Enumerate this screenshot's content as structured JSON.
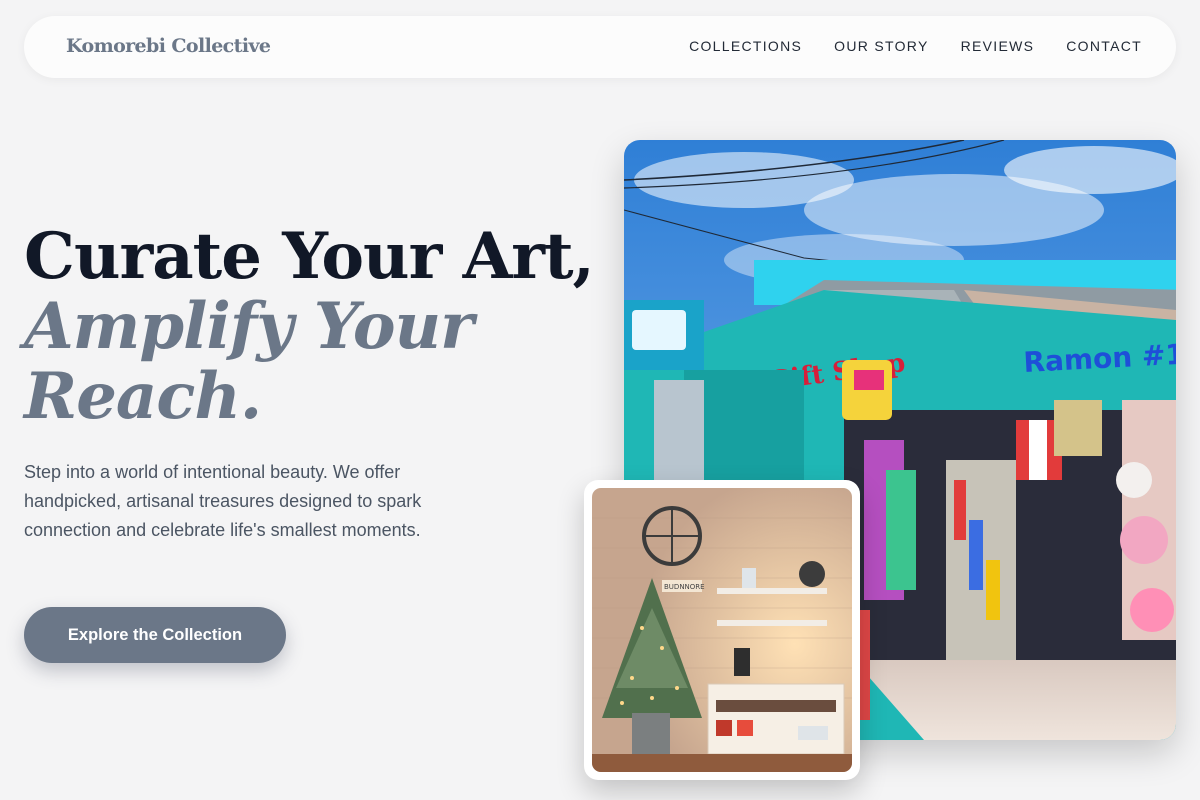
{
  "brand": {
    "name": "Komorebi Collective"
  },
  "nav": {
    "links": [
      "COLLECTIONS",
      "OUR STORY",
      "REVIEWS",
      "CONTACT"
    ]
  },
  "hero": {
    "title_line1": "Curate Your Art,",
    "title_line2": "Amplify Your Reach.",
    "description": "Step into a world of intentional beauty. We offer handpicked, artisanal treasures designed to spark connection and celebrate life's smallest moments.",
    "cta_label": "Explore the Collection"
  },
  "images": {
    "main_signs": [
      "Gift Shop",
      "Ramon #1"
    ],
    "interior_sign": "BUDNNORE"
  },
  "colors": {
    "background": "#f4f4f5",
    "accent": "#6b7788",
    "heading": "#111827",
    "body_text": "#4b5563",
    "nav_text": "#222a36"
  }
}
